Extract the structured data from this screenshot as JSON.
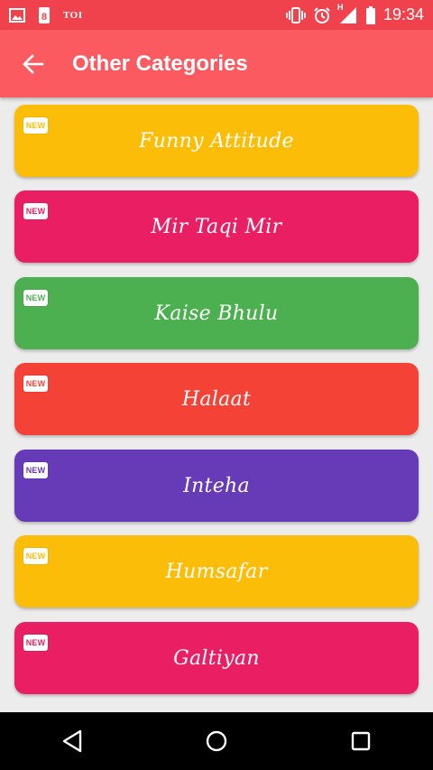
{
  "status_bar": {
    "notification_text": "TOI",
    "time": "19:34",
    "network_label": "H",
    "icons": [
      "image-icon",
      "notification-app-icon",
      "vibrate-icon",
      "alarm-icon",
      "signal-icon",
      "battery-icon"
    ]
  },
  "app_bar": {
    "title": "Other Categories",
    "back_icon": "arrow-left-icon"
  },
  "categories": [
    {
      "label": "Funny Attitude",
      "badge": "NEW",
      "color": "#fbbd08"
    },
    {
      "label": "Mir Taqi Mir",
      "badge": "NEW",
      "color": "#e91e63"
    },
    {
      "label": "Kaise Bhulu",
      "badge": "NEW",
      "color": "#4caf50"
    },
    {
      "label": "Halaat",
      "badge": "NEW",
      "color": "#f44336"
    },
    {
      "label": "Inteha",
      "badge": "NEW",
      "color": "#673ab7"
    },
    {
      "label": "Humsafar",
      "badge": "NEW",
      "color": "#fbbd08"
    },
    {
      "label": "Galtiyan",
      "badge": "NEW",
      "color": "#e91e63"
    }
  ],
  "nav_bar": {
    "icons": [
      "back-triangle-icon",
      "home-circle-icon",
      "recents-square-icon"
    ]
  },
  "colors": {
    "status_bar": "#f0424c",
    "app_bar": "#fb5a60",
    "background": "#ececec",
    "nav_bar": "#000000"
  }
}
